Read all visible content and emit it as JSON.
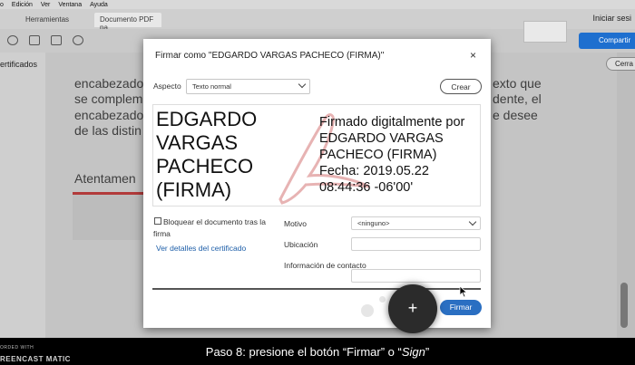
{
  "menubar": {
    "items": [
      "o",
      "Edición",
      "Ver",
      "Ventana",
      "Ayuda"
    ]
  },
  "tabs": [
    {
      "label": ""
    },
    {
      "label": "Herramientas"
    },
    {
      "label": "Documento PDF pa..."
    }
  ],
  "header": {
    "signin": "Iniciar sesi",
    "share": "Compartir"
  },
  "left_panel": {
    "label": "ertificados"
  },
  "right_panel": {
    "close_label": "Cerra"
  },
  "document": {
    "lines": [
      "encabezado",
      "se complem",
      "encabezado",
      "de las distin",
      "Atentamen"
    ],
    "right_lines": [
      "exto que",
      "dente, el",
      "e desee"
    ]
  },
  "dialog": {
    "title": "Firmar como \"EDGARDO VARGAS PACHECO (FIRMA)\"",
    "close_glyph": "×",
    "aspect_label": "Aspecto",
    "aspect_value": "Texto normal",
    "create_button": "Crear",
    "signature": {
      "name": "EDGARDO VARGAS PACHECO (FIRMA)",
      "info": "Firmado digitalmente por EDGARDO VARGAS PACHECO (FIRMA) Fecha: 2019.05.22 08:44:36 -06'00'"
    },
    "lock_label": "Bloquear el documento tras la firma",
    "cert_link": "Ver detalles del certificado",
    "motivo_label": "Motivo",
    "motivo_value": "<ninguno>",
    "ubicacion_label": "Ubicación",
    "contacto_label": "Información de contacto",
    "sign_button": "Firmar"
  },
  "overlay": {
    "fab_glyph": "+"
  },
  "caption": {
    "text_before": "Paso 8: presione el botón “Firmar” o “",
    "text_italic": "Sign",
    "text_after": "”"
  },
  "watermark": {
    "top": "ORDED WITH",
    "bottom": "REENCAST  MATIC"
  },
  "colors": {
    "accent": "#2a6fc2",
    "link": "#1d5ea8",
    "doc_red": "#b23a3a"
  },
  "icons": [
    "print-icon",
    "mail-icon",
    "search-icon",
    "upload-icon",
    "close-icon",
    "chevron-down-icon",
    "adobe-logo-icon",
    "plus-icon",
    "cursor-icon"
  ]
}
